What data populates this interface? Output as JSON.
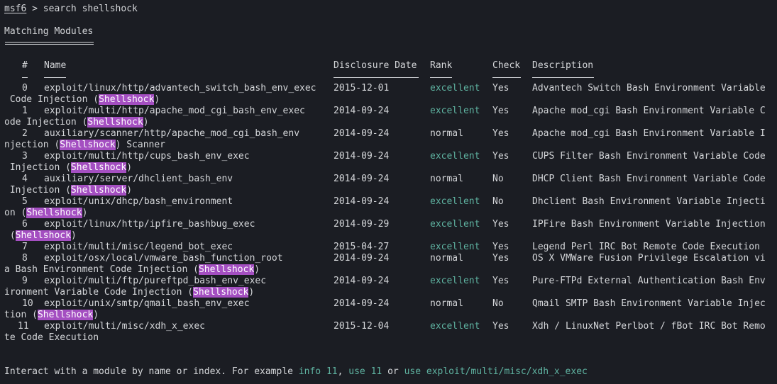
{
  "prompt": {
    "host": "msf6",
    "arrow": " > ",
    "command": "search shellshock"
  },
  "heading": "Matching Modules",
  "columns": {
    "num": "#",
    "name": "Name",
    "date": "Disclosure Date",
    "rank": "Rank",
    "check": "Check",
    "desc": "Description"
  },
  "rows": [
    {
      "num": "0",
      "name": "exploit/linux/http/advantech_switch_bash_env_exec",
      "date": "2015-12-01",
      "rank": "excellent",
      "check": "Yes",
      "desc": "Advantech Switch Bash Environment Variable",
      "cont_pre": " Code Injection (",
      "term": "Shellshock",
      "cont_post": ")"
    },
    {
      "num": "1",
      "name": "exploit/multi/http/apache_mod_cgi_bash_env_exec",
      "date": "2014-09-24",
      "rank": "excellent",
      "check": "Yes",
      "desc": "Apache mod_cgi Bash Environment Variable C",
      "cont_pre": "ode Injection (",
      "term": "Shellshock",
      "cont_post": ")"
    },
    {
      "num": "2",
      "name": "auxiliary/scanner/http/apache_mod_cgi_bash_env",
      "date": "2014-09-24",
      "rank": "normal",
      "check": "Yes",
      "desc": "Apache mod_cgi Bash Environment Variable I",
      "cont_pre": "njection (",
      "term": "Shellshock",
      "cont_post": ") Scanner"
    },
    {
      "num": "3",
      "name": "exploit/multi/http/cups_bash_env_exec",
      "date": "2014-09-24",
      "rank": "excellent",
      "check": "Yes",
      "desc": "CUPS Filter Bash Environment Variable Code",
      "cont_pre": " Injection (",
      "term": "Shellshock",
      "cont_post": ")"
    },
    {
      "num": "4",
      "name": "auxiliary/server/dhclient_bash_env",
      "date": "2014-09-24",
      "rank": "normal",
      "check": "No",
      "desc": "DHCP Client Bash Environment Variable Code",
      "cont_pre": " Injection (",
      "term": "Shellshock",
      "cont_post": ")"
    },
    {
      "num": "5",
      "name": "exploit/unix/dhcp/bash_environment",
      "date": "2014-09-24",
      "rank": "excellent",
      "check": "No",
      "desc": "Dhclient Bash Environment Variable Injecti",
      "cont_pre": "on (",
      "term": "Shellshock",
      "cont_post": ")"
    },
    {
      "num": "6",
      "name": "exploit/linux/http/ipfire_bashbug_exec",
      "date": "2014-09-29",
      "rank": "excellent",
      "check": "Yes",
      "desc": "IPFire Bash Environment Variable Injection",
      "cont_pre": " (",
      "term": "Shellshock",
      "cont_post": ")"
    },
    {
      "num": "7",
      "name": "exploit/multi/misc/legend_bot_exec",
      "date": "2015-04-27",
      "rank": "excellent",
      "check": "Yes",
      "desc": "Legend Perl IRC Bot Remote Code Execution"
    },
    {
      "num": "8",
      "name": "exploit/osx/local/vmware_bash_function_root",
      "date": "2014-09-24",
      "rank": "normal",
      "check": "Yes",
      "desc": "OS X VMWare Fusion Privilege Escalation vi",
      "cont_pre": "a Bash Environment Code Injection (",
      "term": "Shellshock",
      "cont_post": ")"
    },
    {
      "num": "9",
      "name": "exploit/multi/ftp/pureftpd_bash_env_exec",
      "date": "2014-09-24",
      "rank": "excellent",
      "check": "Yes",
      "desc": "Pure-FTPd External Authentication Bash Env",
      "cont_pre": "ironment Variable Code Injection (",
      "term": "Shellshock",
      "cont_post": ")"
    },
    {
      "num": "10",
      "name": "exploit/unix/smtp/qmail_bash_env_exec",
      "date": "2014-09-24",
      "rank": "normal",
      "check": "No",
      "desc": "Qmail SMTP Bash Environment Variable Injec",
      "cont_pre": "tion (",
      "term": "Shellshock",
      "cont_post": ")"
    },
    {
      "num": "11",
      "name": "exploit/multi/misc/xdh_x_exec",
      "date": "2015-12-04",
      "rank": "excellent",
      "check": "Yes",
      "desc": "Xdh / LinuxNet Perlbot / fBot IRC Bot Remo",
      "cont_pre": "te Code Execution"
    }
  ],
  "footer": {
    "pre": "Interact with a module by name or index. For example ",
    "cmd1": "info 11",
    "sep1": ", ",
    "cmd2": "use 11",
    "sep2": " or ",
    "cmd3": "use exploit/multi/misc/xdh_x_exec"
  },
  "colors": {
    "background": "#1b1d23",
    "text": "#d4d6d9",
    "excellent": "#5fb3a1",
    "highlight": "#a44fc1"
  }
}
